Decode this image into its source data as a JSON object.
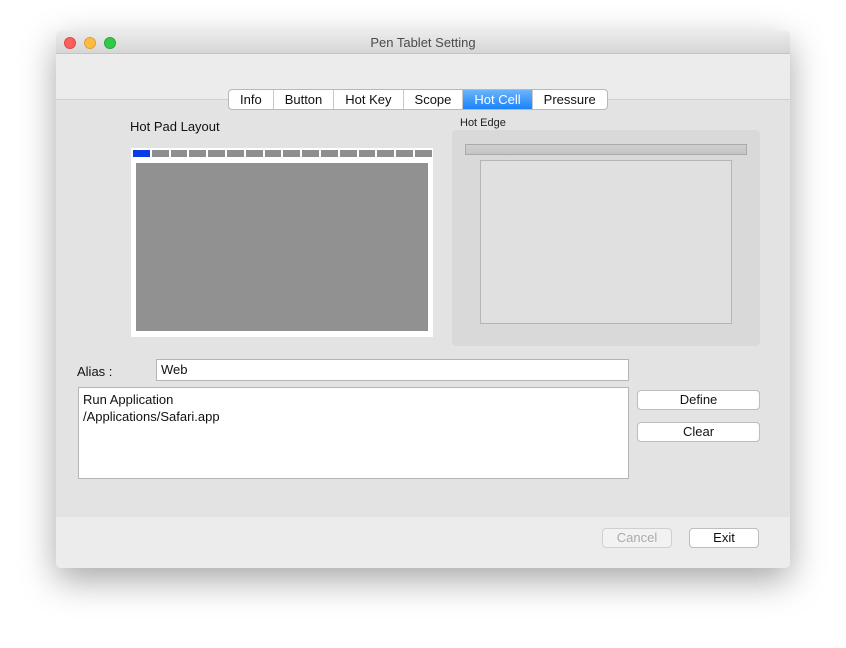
{
  "window": {
    "title": "Pen Tablet Setting"
  },
  "tabs": [
    {
      "label": "Info"
    },
    {
      "label": "Button"
    },
    {
      "label": "Hot Key"
    },
    {
      "label": "Scope"
    },
    {
      "label": "Hot Cell",
      "active": true
    },
    {
      "label": "Pressure"
    }
  ],
  "hot_pad": {
    "label": "Hot Pad Layout",
    "cell_count": 16,
    "selected_cell": 1
  },
  "hot_edge": {
    "label": "Hot Edge"
  },
  "alias": {
    "label": "Alias :",
    "value": "Web"
  },
  "action": {
    "line1": "Run Application",
    "line2": "/Applications/Safari.app"
  },
  "buttons": {
    "define": "Define",
    "clear": "Clear",
    "cancel": "Cancel",
    "exit": "Exit"
  },
  "colors": {
    "accent": "#1a82fb",
    "selected_cell": "#0a3ce8"
  }
}
